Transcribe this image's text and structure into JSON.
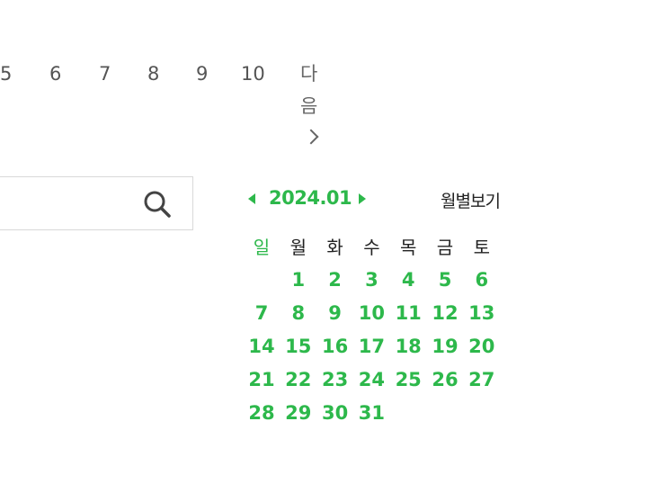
{
  "pagination": {
    "pages": [
      "5",
      "6",
      "7",
      "8",
      "9",
      "10"
    ],
    "next_label": "다음"
  },
  "search": {
    "placeholder": "",
    "icon": "search-icon"
  },
  "calendar": {
    "title": "2024.01",
    "monthly_view_label": "월별보기",
    "weekdays": [
      "일",
      "월",
      "화",
      "수",
      "목",
      "금",
      "토"
    ],
    "days": [
      "1",
      "2",
      "3",
      "4",
      "5",
      "6",
      "7",
      "8",
      "9",
      "10",
      "11",
      "12",
      "13",
      "14",
      "15",
      "16",
      "17",
      "18",
      "19",
      "20",
      "21",
      "22",
      "23",
      "24",
      "25",
      "26",
      "27",
      "28",
      "29",
      "30",
      "31"
    ],
    "first_weekday_index": 1,
    "accent_color": "#2db84b"
  }
}
